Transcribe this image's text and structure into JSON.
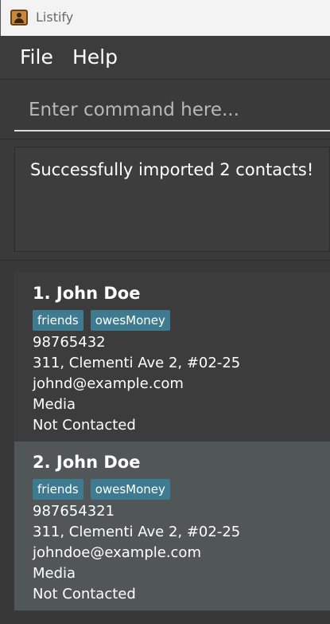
{
  "window": {
    "title": "Listify",
    "icon": "contact-book-icon"
  },
  "menu": {
    "file": "File",
    "help": "Help"
  },
  "command": {
    "placeholder": "Enter command here..."
  },
  "result": {
    "message": "Successfully imported 2 contacts!"
  },
  "colors": {
    "tag": "#3e7b91",
    "selected_card": "#515658"
  },
  "contacts": [
    {
      "name": "1. John Doe",
      "tags": [
        "friends",
        "owesMoney"
      ],
      "phone": "98765432",
      "address": "311, Clementi Ave 2, #02-25",
      "email": "johnd@example.com",
      "category": "Media",
      "status": "Not Contacted"
    },
    {
      "name": "2. John Doe",
      "tags": [
        "friends",
        "owesMoney"
      ],
      "phone": "987654321",
      "address": "311, Clementi Ave 2, #02-25",
      "email": "johndoe@example.com",
      "category": "Media",
      "status": "Not Contacted"
    }
  ]
}
